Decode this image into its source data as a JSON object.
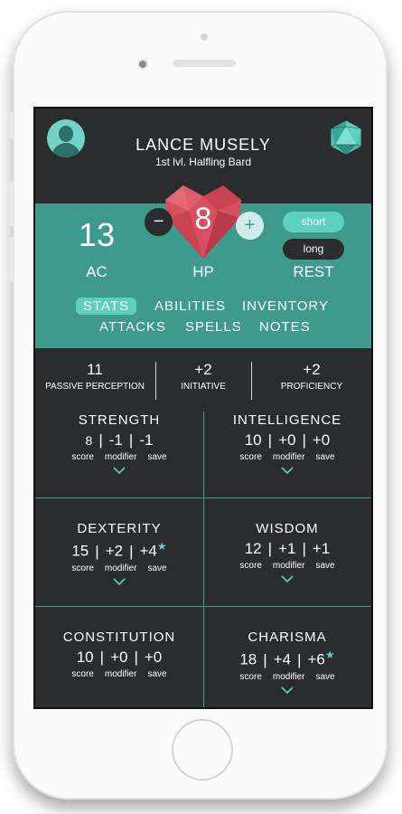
{
  "character": {
    "name": "LANCE MUSELY",
    "subtitle": "1st lvl. Halfling Bard"
  },
  "vitals": {
    "ac_value": "13",
    "ac_label": "AC",
    "hp_value": "8",
    "hp_label": "HP",
    "minus": "−",
    "plus": "+",
    "rest_label": "REST",
    "short_label": "short",
    "long_label": "long"
  },
  "tabs": {
    "row1": [
      "STATS",
      "ABILITIES",
      "INVENTORY"
    ],
    "row2": [
      "ATTACKS",
      "SPELLS",
      "NOTES"
    ],
    "active": "STATS"
  },
  "top_stats": [
    {
      "value": "11",
      "label": "PASSIVE PERCEPTION"
    },
    {
      "value": "+2",
      "label": "INITIATIVE"
    },
    {
      "value": "+2",
      "label": "PROFICIENCY"
    }
  ],
  "sub_labels": {
    "score": "score",
    "modifier": "modifier",
    "save": "save"
  },
  "abilities": [
    {
      "name": "STRENGTH",
      "score": "8",
      "modifier": "-1",
      "save": "-1",
      "proficient": false
    },
    {
      "name": "INTELLIGENCE",
      "score": "10",
      "modifier": "+0",
      "save": "+0",
      "proficient": false
    },
    {
      "name": "DEXTERITY",
      "score": "15",
      "modifier": "+2",
      "save": "+4",
      "proficient": true
    },
    {
      "name": "WISDOM",
      "score": "12",
      "modifier": "+1",
      "save": "+1",
      "proficient": false
    },
    {
      "name": "CONSTITUTION",
      "score": "10",
      "modifier": "+0",
      "save": "+0",
      "proficient": false
    },
    {
      "name": "CHARISMA",
      "score": "18",
      "modifier": "+4",
      "save": "+6",
      "proficient": true
    }
  ],
  "colors": {
    "screen_bg": "#2b2c2e",
    "teal": "#3d9a8d",
    "accent": "#5fd0bf",
    "heart": "#d8505f"
  },
  "icons": [
    "avatar-icon",
    "d20-icon",
    "heart-icon",
    "chevron-down-icon",
    "star-icon"
  ]
}
